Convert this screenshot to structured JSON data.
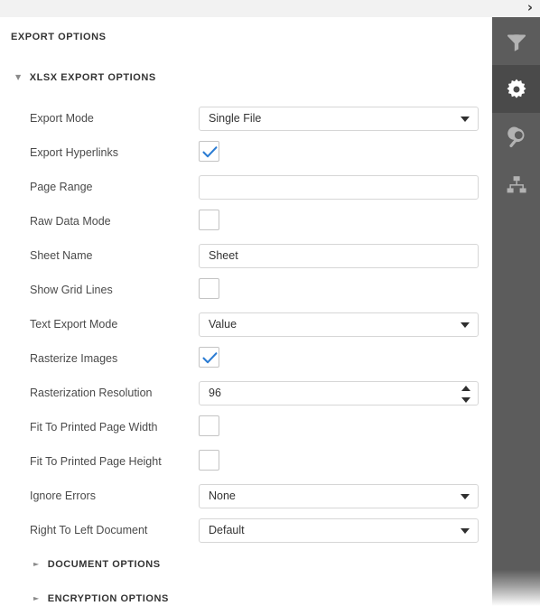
{
  "topbar": {
    "expand_icon": "chevron-right-icon",
    "expand_label": "›"
  },
  "pane": {
    "title": "EXPORT OPTIONS"
  },
  "sections": [
    {
      "id": "xlsx",
      "label": "XLSX EXPORT OPTIONS",
      "expanded": true,
      "marker": "▼"
    },
    {
      "id": "document",
      "label": "DOCUMENT OPTIONS",
      "expanded": false,
      "marker": "►"
    },
    {
      "id": "encryption",
      "label": "ENCRYPTION OPTIONS",
      "expanded": false,
      "marker": "►"
    }
  ],
  "fields": [
    {
      "label": "Export Mode",
      "type": "select",
      "value": "Single File"
    },
    {
      "label": "Export Hyperlinks",
      "type": "checkbox",
      "checked": true
    },
    {
      "label": "Page Range",
      "type": "input",
      "value": ""
    },
    {
      "label": "Raw Data Mode",
      "type": "checkbox",
      "checked": false
    },
    {
      "label": "Sheet Name",
      "type": "input",
      "value": "Sheet"
    },
    {
      "label": "Show Grid Lines",
      "type": "checkbox",
      "checked": false
    },
    {
      "label": "Text Export Mode",
      "type": "select",
      "value": "Value"
    },
    {
      "label": "Rasterize Images",
      "type": "checkbox",
      "checked": true
    },
    {
      "label": "Rasterization Resolution",
      "type": "spinner",
      "value": "96"
    },
    {
      "label": "Fit To Printed Page Width",
      "type": "checkbox",
      "checked": false
    },
    {
      "label": "Fit To Printed Page Height",
      "type": "checkbox",
      "checked": false
    },
    {
      "label": "Ignore Errors",
      "type": "select",
      "value": "None"
    },
    {
      "label": "Right To Left Document",
      "type": "select",
      "value": "Default"
    }
  ],
  "rail": {
    "items": [
      {
        "icon": "filter-funnel-icon",
        "active": false
      },
      {
        "icon": "gear-settings-icon",
        "active": true
      },
      {
        "icon": "search-magnifier-icon",
        "active": false
      },
      {
        "icon": "hierarchy-sitemap-icon",
        "active": false
      }
    ]
  },
  "colors": {
    "accent_check": "#2b7cd3",
    "rail_bg": "#5c5c5c",
    "rail_active_bg": "#4a4a4a",
    "topbar_bg": "#f2f2f2",
    "label_text": "#4a4a4a",
    "border": "#d6d6d6"
  }
}
